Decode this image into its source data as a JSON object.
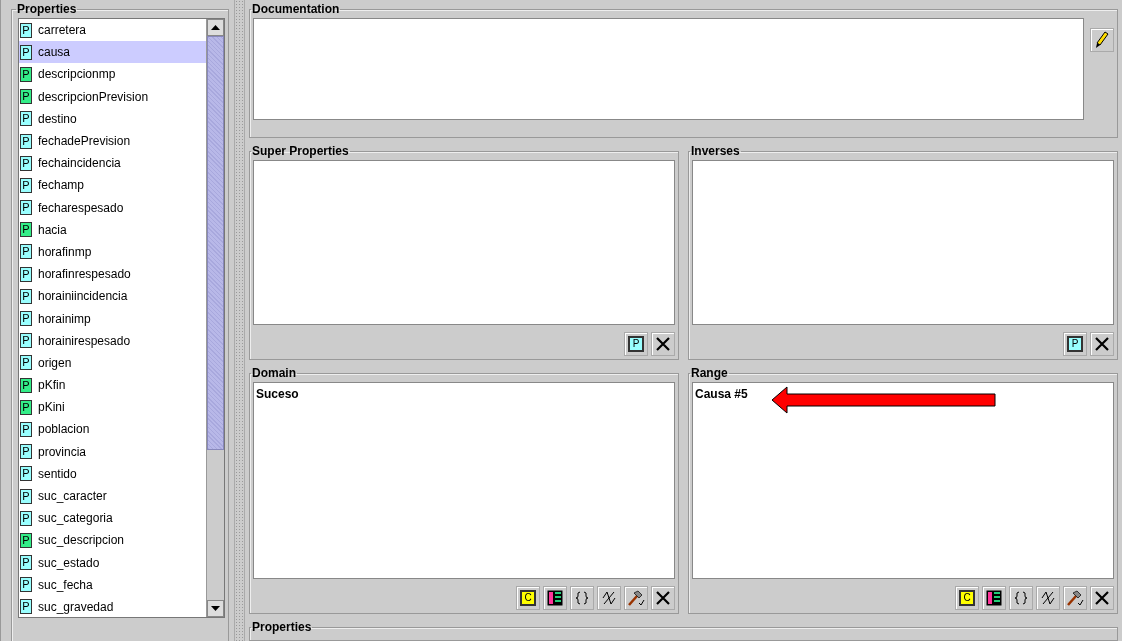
{
  "properties": {
    "title": "Properties",
    "items": [
      {
        "name": "carretera",
        "badge": "P",
        "color": "#99ffff",
        "selected": false
      },
      {
        "name": "causa",
        "badge": "P",
        "color": "#99ffff",
        "selected": true
      },
      {
        "name": "descripcionmp",
        "badge": "P",
        "color": "#33ee88",
        "selected": false
      },
      {
        "name": "descripcionPrevision",
        "badge": "P",
        "color": "#33ee88",
        "selected": false
      },
      {
        "name": "destino",
        "badge": "P",
        "color": "#99ffff",
        "selected": false
      },
      {
        "name": "fechadePrevision",
        "badge": "P",
        "color": "#99ffff",
        "selected": false
      },
      {
        "name": "fechaincidencia",
        "badge": "P",
        "color": "#99ffff",
        "selected": false
      },
      {
        "name": "fechamp",
        "badge": "P",
        "color": "#99ffff",
        "selected": false
      },
      {
        "name": "fecharespesado",
        "badge": "P",
        "color": "#99ffff",
        "selected": false
      },
      {
        "name": "hacia",
        "badge": "P",
        "color": "#33ee88",
        "selected": false
      },
      {
        "name": "horafinmp",
        "badge": "P",
        "color": "#99ffff",
        "selected": false
      },
      {
        "name": "horafinrespesado",
        "badge": "P",
        "color": "#99ffff",
        "selected": false
      },
      {
        "name": "horainiincidencia",
        "badge": "P",
        "color": "#99ffff",
        "selected": false
      },
      {
        "name": "horainimp",
        "badge": "P",
        "color": "#99ffff",
        "selected": false
      },
      {
        "name": "horainirespesado",
        "badge": "P",
        "color": "#99ffff",
        "selected": false
      },
      {
        "name": "origen",
        "badge": "P",
        "color": "#99ffff",
        "selected": false
      },
      {
        "name": "pKfin",
        "badge": "P",
        "color": "#33ee88",
        "selected": false
      },
      {
        "name": "pKini",
        "badge": "P",
        "color": "#33ee88",
        "selected": false
      },
      {
        "name": "poblacion",
        "badge": "P",
        "color": "#99ffff",
        "selected": false
      },
      {
        "name": "provincia",
        "badge": "P",
        "color": "#99ffff",
        "selected": false
      },
      {
        "name": "sentido",
        "badge": "P",
        "color": "#99ffff",
        "selected": false
      },
      {
        "name": "suc_caracter",
        "badge": "P",
        "color": "#99ffff",
        "selected": false
      },
      {
        "name": "suc_categoria",
        "badge": "P",
        "color": "#99ffff",
        "selected": false
      },
      {
        "name": "suc_descripcion",
        "badge": "P",
        "color": "#33ee88",
        "selected": false
      },
      {
        "name": "suc_estado",
        "badge": "P",
        "color": "#99ffff",
        "selected": false
      },
      {
        "name": "suc_fecha",
        "badge": "P",
        "color": "#99ffff",
        "selected": false
      },
      {
        "name": "suc_gravedad",
        "badge": "P",
        "color": "#99ffff",
        "selected": false
      }
    ]
  },
  "documentation": {
    "title": "Documentation"
  },
  "super_properties": {
    "title": "Super Properties",
    "buttons": [
      {
        "kind": "property",
        "label": "P"
      },
      {
        "kind": "delete"
      }
    ]
  },
  "inverses": {
    "title": "Inverses",
    "buttons": [
      {
        "kind": "property",
        "label": "P"
      },
      {
        "kind": "delete"
      }
    ]
  },
  "domain": {
    "title": "Domain",
    "values": [
      "Suceso"
    ],
    "buttons": [
      {
        "kind": "class",
        "label": "C"
      },
      {
        "kind": "metaclass"
      },
      {
        "kind": "braces"
      },
      {
        "kind": "expression"
      },
      {
        "kind": "hammer"
      },
      {
        "kind": "delete"
      }
    ]
  },
  "range": {
    "title": "Range",
    "values": [
      "Causa #5"
    ],
    "arrow": true,
    "buttons": [
      {
        "kind": "class",
        "label": "C"
      },
      {
        "kind": "metaclass"
      },
      {
        "kind": "braces"
      },
      {
        "kind": "expression"
      },
      {
        "kind": "hammer"
      },
      {
        "kind": "delete"
      }
    ]
  },
  "bottom_panel": {
    "title": "Properties"
  }
}
